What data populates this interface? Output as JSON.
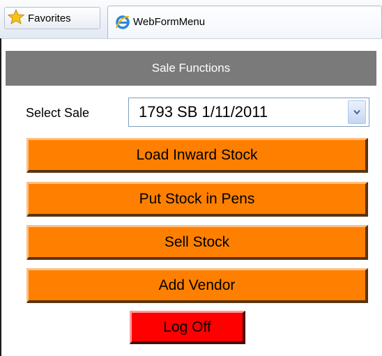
{
  "browser": {
    "favorites_label": "Favorites",
    "favorites_icon": "star-icon",
    "tab_title": "WebFormMenu",
    "tab_icon": "ie-icon"
  },
  "panel": {
    "header": "Sale Functions",
    "select_label": "Select Sale",
    "selected_sale": "1793  SB 1/11/2011",
    "dropdown_icon": "chevron-down-icon"
  },
  "buttons": [
    {
      "label": "Load Inward Stock"
    },
    {
      "label": "Put Stock in Pens"
    },
    {
      "label": "Sell Stock"
    },
    {
      "label": "Add Vendor"
    }
  ],
  "logoff_label": "Log Off",
  "colors": {
    "header_bg": "#7a7a7a",
    "button_bg": "#ff8000",
    "logoff_bg": "#ff0000"
  }
}
